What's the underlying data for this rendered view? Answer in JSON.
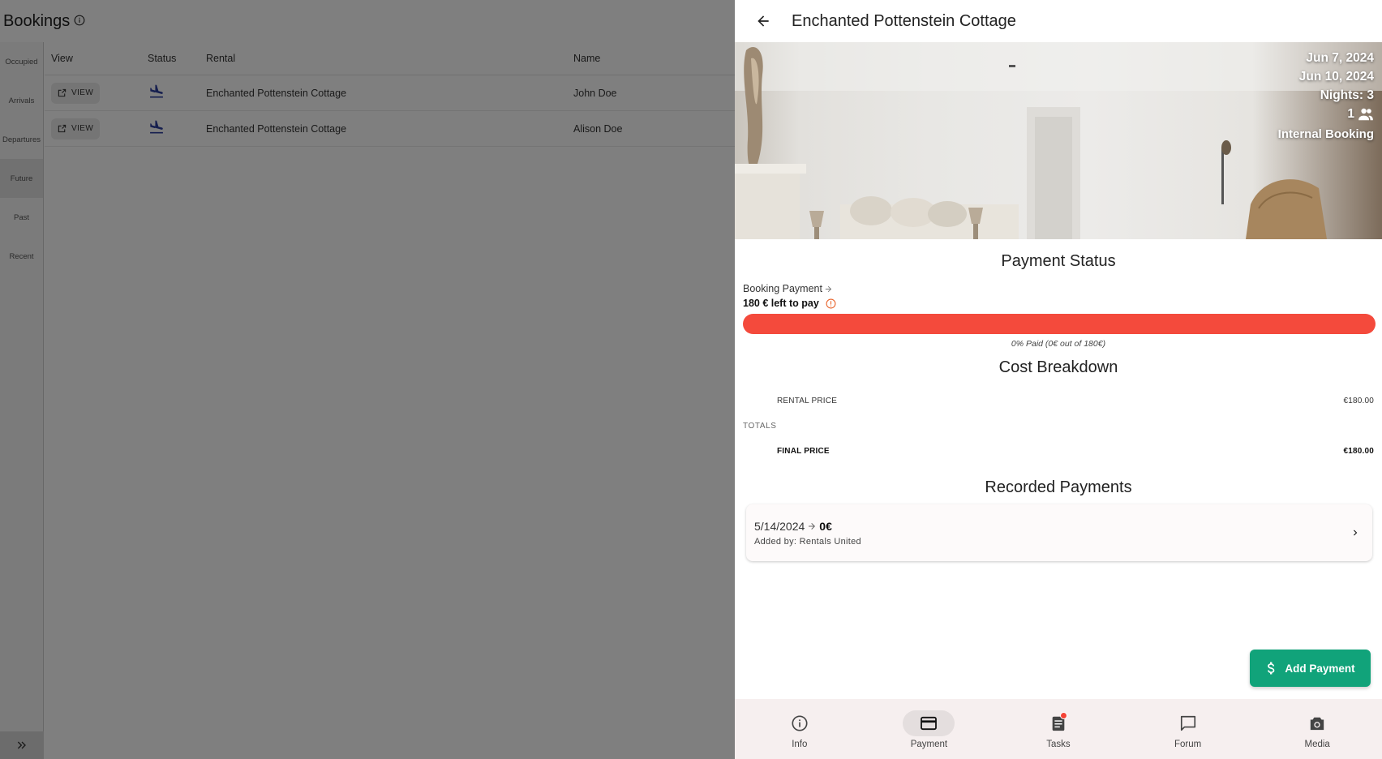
{
  "bookings_page": {
    "title": "Bookings",
    "rail_items": [
      "Occupied",
      "Arrivals",
      "Departures",
      "Future",
      "Past",
      "Recent"
    ],
    "active_rail_item": "Future",
    "table": {
      "headers": [
        "View",
        "Status",
        "Rental",
        "Name"
      ],
      "view_label": "VIEW",
      "rows": [
        {
          "rental": "Enchanted Pottenstein Cottage",
          "name": "John Doe"
        },
        {
          "rental": "Enchanted Pottenstein Cottage",
          "name": "Alison Doe"
        }
      ]
    }
  },
  "drawer": {
    "title": "Enchanted Pottenstein Cottage",
    "hero": {
      "check_in": "Jun 7, 2024",
      "check_out": "Jun 10, 2024",
      "nights": "Nights: 3",
      "guests": "1",
      "booking_type": "Internal Booking"
    },
    "payment_status": {
      "title": "Payment Status",
      "booking_payment_label": "Booking Payment",
      "left_to_pay": "180 € left to pay",
      "paid_fraction": 0,
      "progress_caption": "0% Paid (0€ out of 180€)"
    },
    "cost_breakdown": {
      "title": "Cost Breakdown",
      "rental_price_label": "RENTAL PRICE",
      "rental_price_value": "€180.00",
      "totals_label": "TOTALS",
      "final_price_label": "FINAL PRICE",
      "final_price_value": "€180.00"
    },
    "recorded_payments": {
      "title": "Recorded Payments",
      "items": [
        {
          "date": "5/14/2024",
          "amount": "0€",
          "added_by": "Added by: Rentals United"
        }
      ]
    },
    "add_payment_label": "Add Payment",
    "bottom_nav": {
      "items": [
        "Info",
        "Payment",
        "Tasks",
        "Forum",
        "Media"
      ],
      "active": "Payment"
    },
    "colors": {
      "progress_unpaid": "#f44a3c",
      "add_payment": "#11a37a",
      "status_icon": "#2c3e9e",
      "warning_icon": "#e8632b"
    }
  }
}
